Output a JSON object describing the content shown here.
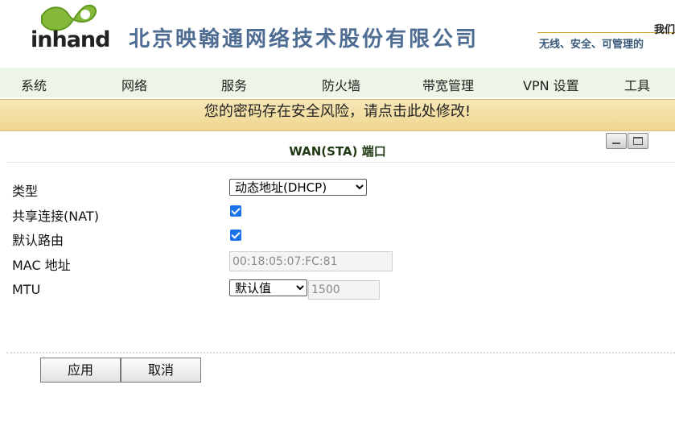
{
  "header": {
    "logo_text": "inhand",
    "company_name": "北京映翰通网络技术股份有限公司",
    "slogan_line1": "我们",
    "slogan_line2": "无线、安全、可管理的"
  },
  "nav": {
    "items": [
      "系统",
      "网络",
      "服务",
      "防火墙",
      "带宽管理",
      "VPN 设置",
      "工具"
    ]
  },
  "warning": "您的密码存在安全风险，请点击此处修改!",
  "panel": {
    "title": "WAN(STA) 端口",
    "fields": {
      "type_label": "类型",
      "type_value": "动态地址(DHCP)",
      "nat_label": "共享连接(NAT)",
      "nat_checked": true,
      "default_route_label": "默认路由",
      "default_route_checked": true,
      "mac_label": "MAC 地址",
      "mac_value": "00:18:05:07:FC:81",
      "mtu_label": "MTU",
      "mtu_mode": "默认值",
      "mtu_value": "1500"
    }
  },
  "buttons": {
    "apply": "应用",
    "cancel": "取消"
  },
  "colors": {
    "nav_bg": "#edf6e6",
    "warning_bg": "#f2dc9c",
    "company_text": "#4f6d93",
    "logo_green": "#86b83c",
    "checkbox": "#1a73e8"
  }
}
